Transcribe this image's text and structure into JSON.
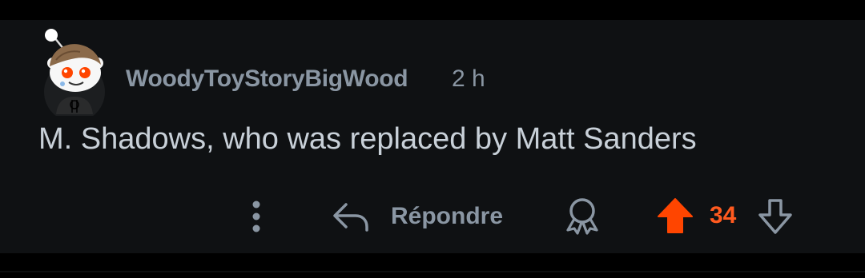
{
  "comment": {
    "username": "WoodyToyStoryBigWood",
    "timestamp": "2 h",
    "body": "M. Shadows, who was replaced by Matt Sanders",
    "score": "34",
    "voted": "up"
  },
  "actions": {
    "more_icon": "more-vertical-icon",
    "reply_icon": "reply-arrow-icon",
    "reply_label": "Répondre",
    "award_icon": "award-icon",
    "upvote_icon": "upvote-arrow-icon",
    "downvote_icon": "downvote-arrow-icon"
  },
  "colors": {
    "background": "#0f1113",
    "text_secondary": "#8a96a3",
    "text_primary": "#c8d0d8",
    "upvote_active": "#ff4500",
    "score_active": "#ff5a1f"
  }
}
